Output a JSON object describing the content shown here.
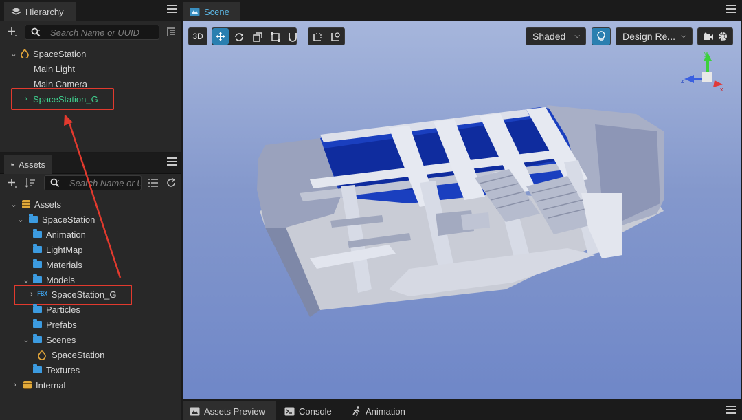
{
  "hierarchy": {
    "title": "Hierarchy",
    "search_placeholder": "Search Name or UUID",
    "items": [
      {
        "label": "SpaceStation",
        "icon": "cocos-scene-icon"
      },
      {
        "label": "Main Light"
      },
      {
        "label": "Main Camera"
      },
      {
        "label": "SpaceStation_G",
        "color": "#3fcf8e"
      }
    ]
  },
  "assets": {
    "title": "Assets",
    "search_placeholder": "Search Name or UUID",
    "items": [
      {
        "label": "Assets"
      },
      {
        "label": "SpaceStation"
      },
      {
        "label": "Animation"
      },
      {
        "label": "LightMap"
      },
      {
        "label": "Materials"
      },
      {
        "label": "Models"
      },
      {
        "label": "SpaceStation_G",
        "badge": "FBX"
      },
      {
        "label": "Particles"
      },
      {
        "label": "Prefabs"
      },
      {
        "label": "Scenes"
      },
      {
        "label": "SpaceStation"
      },
      {
        "label": "Textures"
      },
      {
        "label": "Internal"
      }
    ]
  },
  "scene": {
    "title": "Scene",
    "mode_3d": "3D",
    "shading": "Shaded",
    "resolution": "Design Re...",
    "gizmo": {
      "x": "x",
      "y": "y",
      "z": "z"
    }
  },
  "bottom_tabs": [
    {
      "label": "Assets Preview"
    },
    {
      "label": "Console"
    },
    {
      "label": "Animation"
    }
  ],
  "colors": {
    "accent": "#2a7fb0",
    "highlight": "#e23a2e",
    "node_green": "#3fcf8e"
  }
}
